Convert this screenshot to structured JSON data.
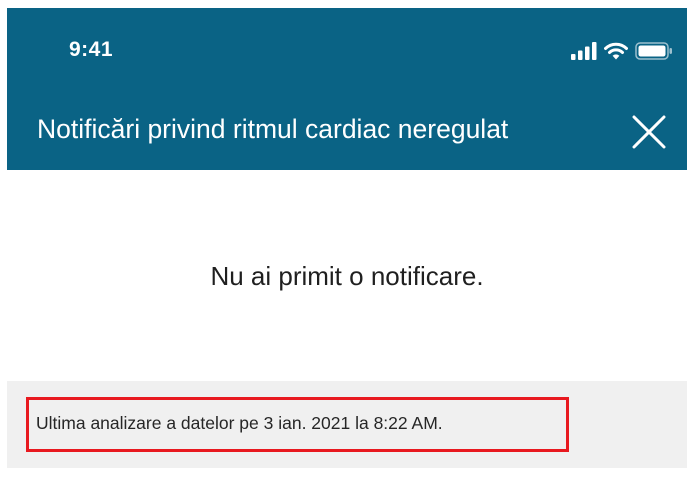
{
  "status_bar": {
    "time": "9:41",
    "icons": [
      "signal-icon",
      "wifi-icon",
      "battery-icon"
    ]
  },
  "header": {
    "title": "Notificări privind ritmul cardiac neregulat",
    "close_icon": "close-icon"
  },
  "content": {
    "message": "Nu ai primit o notificare."
  },
  "footer": {
    "last_analysis": "Ultima analizare a datelor pe 3 ian. 2021 la 8:22 AM."
  },
  "colors": {
    "header_bg": "#0a6385",
    "highlight_border": "#e8191f",
    "footer_bg": "#f0f0f0"
  }
}
